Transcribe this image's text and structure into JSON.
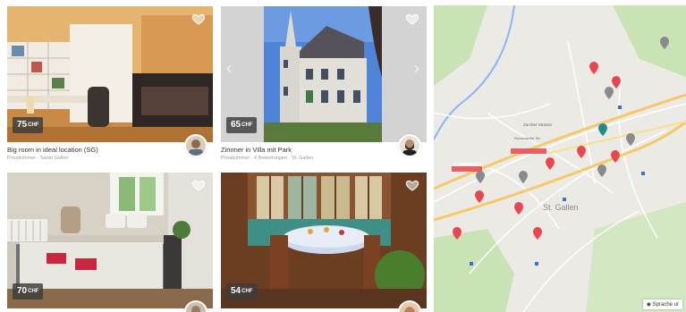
{
  "listings": [
    {
      "title": "Big room in ideal location (SG)",
      "subtitle": "Privatzimmer · Sankt Gallen",
      "price": "75",
      "currency": "CHF"
    },
    {
      "title": "Zimmer in Villa mit Park",
      "subtitle": "Privatzimmer · 4 Bewertungen · St. Gallen",
      "price": "65",
      "currency": "CHF"
    },
    {
      "title": "",
      "subtitle": "",
      "price": "70",
      "currency": "CHF"
    },
    {
      "title": "",
      "subtitle": "",
      "price": "54",
      "currency": "CHF"
    }
  ],
  "map": {
    "labels": {
      "city_label": "St. Gallen",
      "street_1": "Zürcher Strasse",
      "street_2": "Rorschacher Str.",
      "street_3": "St. Gallen Haggen",
      "link": "Sprache ur"
    },
    "colors": {
      "marker_red": "#e8474f",
      "marker_gray": "#8a8a8a",
      "marker_teal": "#1f8b8c",
      "highway": "#f3c969",
      "water": "#8ab4f8",
      "park": "#c9e3b5"
    }
  }
}
